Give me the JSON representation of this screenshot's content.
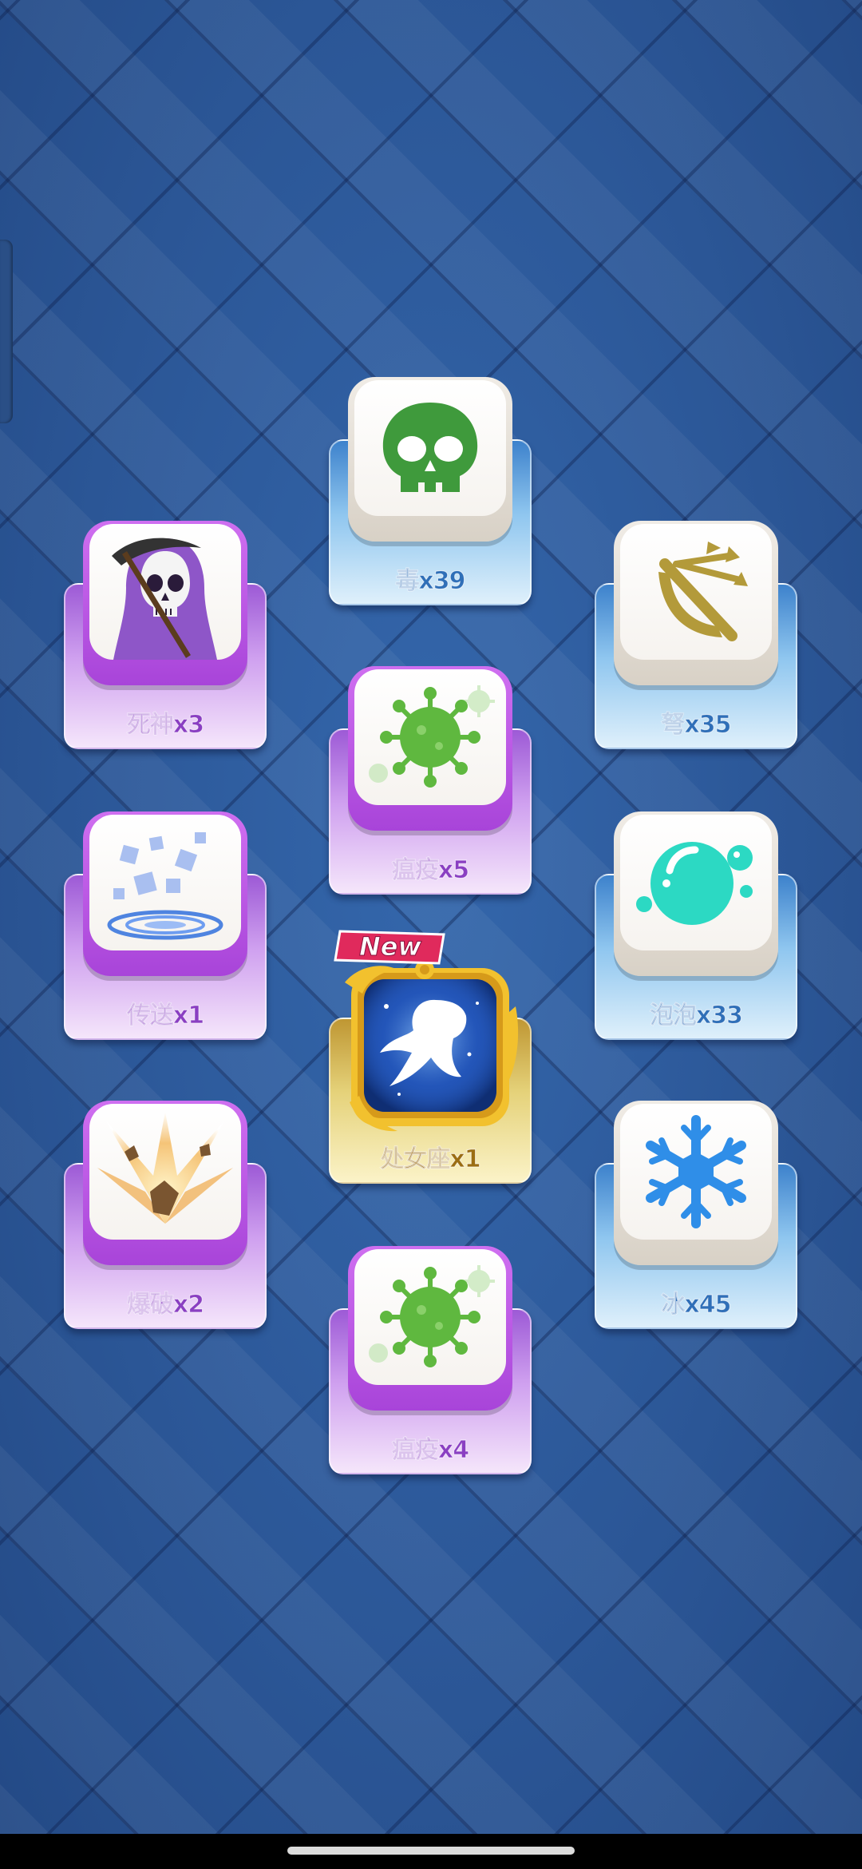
{
  "cards": {
    "poison": {
      "label": "毒x39",
      "icon": "skull-icon",
      "color": "#3f9a3c"
    },
    "reaper": {
      "label": "死神x3",
      "icon": "grim-reaper-icon",
      "color": "#8e56c8"
    },
    "crossbow": {
      "label": "弩x35",
      "icon": "crossbow-icon",
      "color": "#b39a3a"
    },
    "plague_a": {
      "label": "瘟疫x5",
      "icon": "virus-icon",
      "color": "#5fb83f"
    },
    "teleport": {
      "label": "传送x1",
      "icon": "teleport-icon",
      "color": "#5b8fe0"
    },
    "bubble": {
      "label": "泡泡x33",
      "icon": "bubble-icon",
      "color": "#2cd9c3"
    },
    "virgo": {
      "label": "处女座x1",
      "icon": "virgo-constellation-icon",
      "badge": "New",
      "color": "#1f4fb2"
    },
    "blast": {
      "label": "爆破x2",
      "icon": "explosion-icon",
      "color": "#f0a94a"
    },
    "ice": {
      "label": "冰x45",
      "icon": "snowflake-icon",
      "color": "#2f8ee8"
    },
    "plague_b": {
      "label": "瘟疫x4",
      "icon": "virus-icon",
      "color": "#5fb83f"
    }
  }
}
